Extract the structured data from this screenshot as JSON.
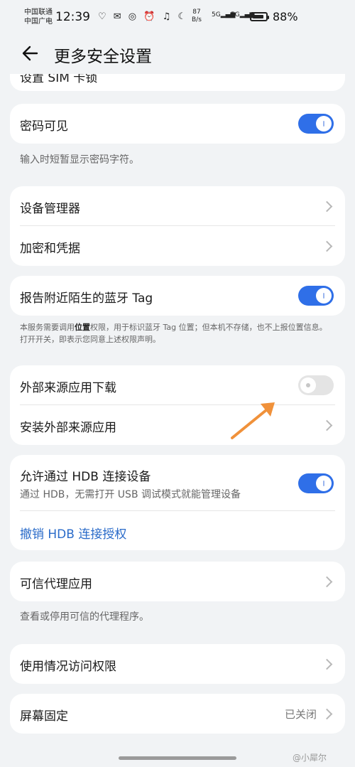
{
  "status_bar": {
    "carrier_1": "中国联通",
    "carrier_2": "中国广电",
    "time": "12:39",
    "icons_text": "♡ ✉ ◎ ⏰ ♫ ☾",
    "net_speed_value": "87",
    "net_speed_unit": "B/s",
    "sig1": "5G",
    "sig2": "5G",
    "battery": "88%",
    "battery_level": 0.88
  },
  "header": {
    "title": "更多安全设置"
  },
  "top_partial": {
    "label": "设置 SIM 卡锁"
  },
  "password_visible": {
    "label": "密码可见",
    "enabled": true,
    "note": "输入时短暂显示密码字符。"
  },
  "device_admin": {
    "label": "设备管理器"
  },
  "encryption": {
    "label": "加密和凭据"
  },
  "bluetooth_tag": {
    "label": "报告附近陌生的蓝牙 Tag",
    "enabled": true,
    "note_prefix": "本服务需要调用",
    "note_bold": "位置",
    "note_suffix": "权限，用于标识蓝牙 Tag 位置；但本机不存储，也不上报位置信息。打开开关，即表示您同意上述权限声明。"
  },
  "external_download": {
    "label": "外部来源应用下载",
    "enabled": false
  },
  "install_external": {
    "label": "安装外部来源应用"
  },
  "hdb": {
    "label": "允许通过 HDB 连接设备",
    "sub": "通过 HDB，无需打开 USB 调试模式就能管理设备",
    "enabled": true,
    "revoke_label": "撤销 HDB 连接授权"
  },
  "trusted_agents": {
    "label": "可信代理应用",
    "note": "查看或停用可信的代理程序。"
  },
  "usage_access": {
    "label": "使用情况访问权限"
  },
  "screen_pinning": {
    "label": "屏幕固定",
    "value": "已关闭"
  },
  "watermark": "@小犀尔",
  "colors": {
    "accent": "#2f6fe8",
    "link": "#2a6bc9",
    "arrow": "#f0913a"
  }
}
